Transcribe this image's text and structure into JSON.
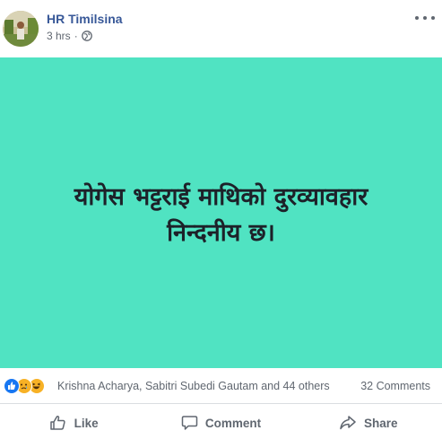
{
  "post": {
    "author": "HR Timilsina",
    "time": "3 hrs",
    "separator": "·",
    "privacy_icon": "globe-icon",
    "text_line_1": "योगेस भट्टराई माथिको दुरव्यावहार",
    "text_line_2": "निन्दनीय छ।",
    "background_color": "#50e3c2"
  },
  "reactions": {
    "icons": [
      "like-reaction-icon",
      "sad-reaction-icon",
      "haha-reaction-icon"
    ],
    "summary": "Krishna Acharya, Sabitri Subedi Gautam and 44 others",
    "comments": "32 Comments"
  },
  "actions": {
    "like": "Like",
    "comment": "Comment",
    "share": "Share"
  }
}
